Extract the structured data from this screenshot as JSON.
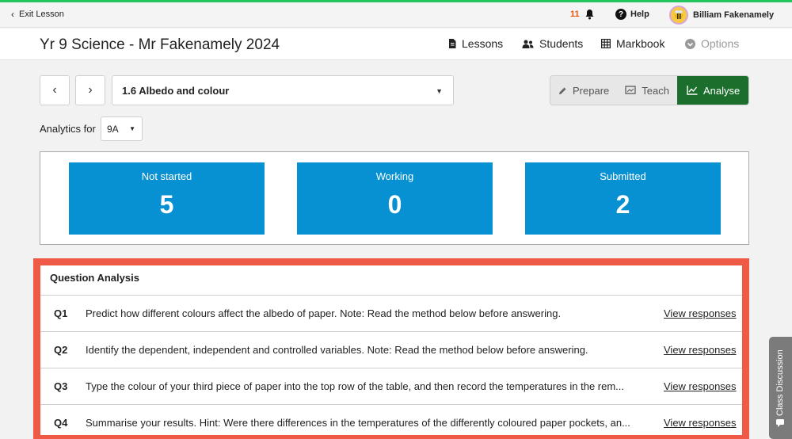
{
  "topbar": {
    "exit_label": "Exit Lesson",
    "notification_count": "11",
    "help_label": "Help",
    "user_name": "Billiam Fakenamely"
  },
  "header": {
    "course_title": "Yr 9 Science - Mr Fakenamely 2024",
    "nav": {
      "lessons": "Lessons",
      "students": "Students",
      "markbook": "Markbook",
      "options": "Options"
    }
  },
  "lesson_bar": {
    "selected_lesson": "1.6 Albedo and colour",
    "modes": {
      "prepare": "Prepare",
      "teach": "Teach",
      "analyse": "Analyse"
    }
  },
  "analytics": {
    "label": "Analytics for",
    "class_value": "9A"
  },
  "stats": {
    "not_started": {
      "label": "Not started",
      "value": "5"
    },
    "working": {
      "label": "Working",
      "value": "0"
    },
    "submitted": {
      "label": "Submitted",
      "value": "2"
    }
  },
  "question_analysis": {
    "title": "Question Analysis",
    "view_label": "View responses",
    "rows": [
      {
        "num": "Q1",
        "text": "Predict how different colours affect the albedo of paper. Note: Read the method below before answering."
      },
      {
        "num": "Q2",
        "text": "Identify the dependent, independent and controlled variables. Note: Read the method below before answering."
      },
      {
        "num": "Q3",
        "text": "Type the colour of your third piece of paper into the top row of the table, and then record the temperatures in the rem..."
      },
      {
        "num": "Q4",
        "text": "Summarise your results. Hint: Were there differences in the temperatures of the differently coloured paper pockets, an..."
      }
    ]
  },
  "class_discussion": {
    "label": "Class Discussion"
  },
  "colors": {
    "accent_green": "#1b6e2c",
    "stat_blue": "#0791d2",
    "highlight_red": "#ef5a47",
    "notification_orange": "#e8590c"
  }
}
